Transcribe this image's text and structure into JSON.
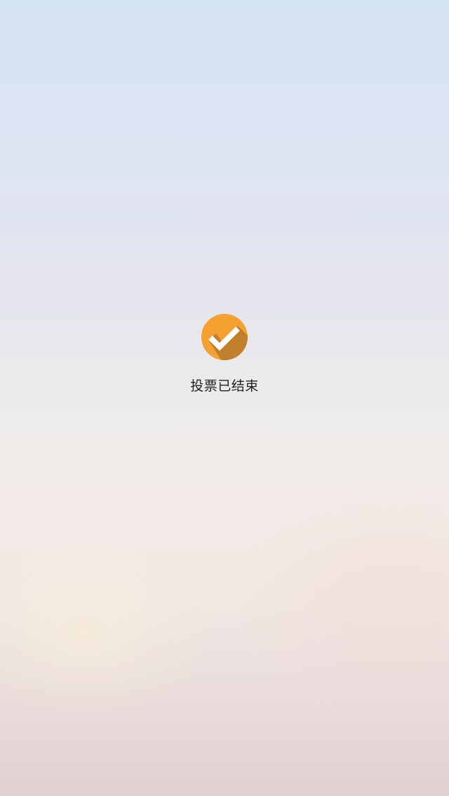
{
  "status": {
    "icon": "check-circle-icon",
    "icon_color": "#f5a132",
    "icon_shadow_color": "#c17f2b",
    "message": "投票已结束"
  }
}
